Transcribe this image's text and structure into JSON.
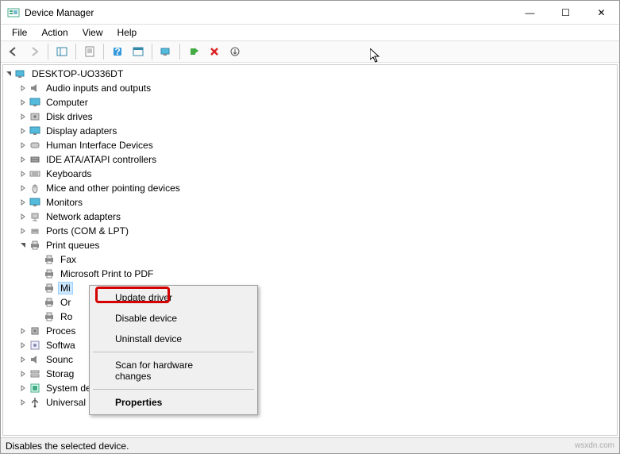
{
  "window": {
    "title": "Device Manager",
    "buttons": {
      "min": "—",
      "max": "☐",
      "close": "✕"
    }
  },
  "menubar": [
    "File",
    "Action",
    "View",
    "Help"
  ],
  "tree": {
    "root": "DESKTOP-UO336DT",
    "items": [
      {
        "label": "Audio inputs and outputs",
        "icon": "speaker"
      },
      {
        "label": "Computer",
        "icon": "monitor"
      },
      {
        "label": "Disk drives",
        "icon": "disk"
      },
      {
        "label": "Display adapters",
        "icon": "monitor"
      },
      {
        "label": "Human Interface Devices",
        "icon": "hid"
      },
      {
        "label": "IDE ATA/ATAPI controllers",
        "icon": "ide"
      },
      {
        "label": "Keyboards",
        "icon": "keyboard"
      },
      {
        "label": "Mice and other pointing devices",
        "icon": "mouse"
      },
      {
        "label": "Monitors",
        "icon": "monitor"
      },
      {
        "label": "Network adapters",
        "icon": "network"
      },
      {
        "label": "Ports (COM & LPT)",
        "icon": "port"
      },
      {
        "label": "Print queues",
        "icon": "printer",
        "expanded": true,
        "children": [
          {
            "label": "Fax",
            "icon": "printer"
          },
          {
            "label": "Microsoft Print to PDF",
            "icon": "printer"
          },
          {
            "label": "Mi",
            "icon": "printer",
            "selected": true
          },
          {
            "label": "Or",
            "icon": "printer"
          },
          {
            "label": "Ro",
            "icon": "printer"
          }
        ]
      },
      {
        "label": "Proces",
        "icon": "cpu"
      },
      {
        "label": "Softwa",
        "icon": "software"
      },
      {
        "label": "Sounc",
        "icon": "speaker"
      },
      {
        "label": "Storag",
        "icon": "storage"
      },
      {
        "label": "System devices",
        "icon": "system"
      },
      {
        "label": "Universal Serial Bus controllers",
        "icon": "usb"
      }
    ]
  },
  "contextmenu": {
    "items": [
      {
        "label": "Update driver",
        "highlighted": true
      },
      {
        "label": "Disable device"
      },
      {
        "label": "Uninstall device"
      },
      {
        "sep": true
      },
      {
        "label": "Scan for hardware changes"
      },
      {
        "sep": true
      },
      {
        "label": "Properties",
        "bold": true
      }
    ]
  },
  "statusbar": "Disables the selected device.",
  "watermark": "wsxdn.com"
}
